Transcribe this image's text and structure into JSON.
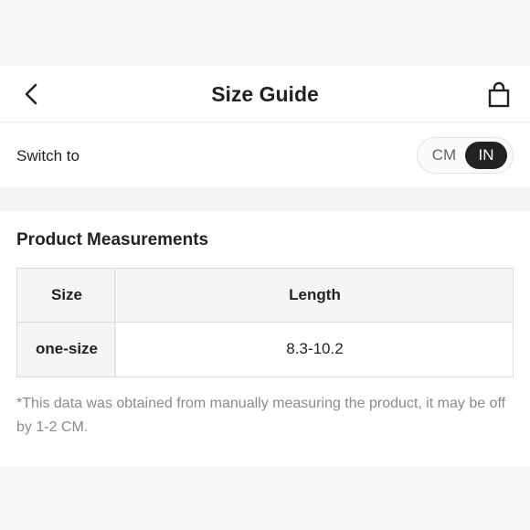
{
  "header": {
    "title": "Size Guide",
    "back_icon": "chevron-left-icon",
    "bag_icon": "shopping-bag-icon"
  },
  "unit_switch": {
    "label": "Switch to",
    "options": [
      "CM",
      "IN"
    ],
    "selected": "IN"
  },
  "measurements": {
    "heading": "Product Measurements",
    "columns": [
      "Size",
      "Length"
    ],
    "rows": [
      {
        "size": "one-size",
        "length": "8.3-10.2"
      }
    ],
    "note": "*This data was obtained from manually measuring the product, it may be off by 1-2 CM."
  },
  "colors": {
    "accent": "#222222",
    "muted_text": "#8a8a8a",
    "table_header_bg": "#f5f5f5",
    "border": "#dcdcdc"
  }
}
